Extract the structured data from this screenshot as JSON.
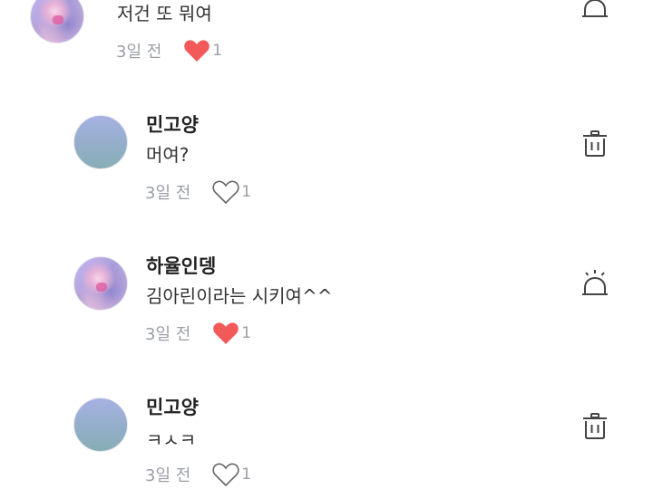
{
  "comments": [
    {
      "type": "partial",
      "text": "저건 또 뭐여",
      "time": "3일 전",
      "liked": true,
      "likes": "1",
      "action": "report-icon"
    },
    {
      "type": "reply",
      "author": "민고양",
      "text": "머여?",
      "time": "3일 전",
      "liked": false,
      "likes": "1",
      "action": "trash-icon"
    },
    {
      "type": "reply",
      "author": "하율인뎅",
      "text": "김아린이라는 시키여^^",
      "time": "3일 전",
      "liked": true,
      "likes": "1",
      "action": "report-icon"
    },
    {
      "type": "reply",
      "author": "민고양",
      "text": "ㅋㅅㅋ",
      "time": "3일 전",
      "liked": false,
      "likes": "1",
      "action": "trash-icon"
    }
  ],
  "colors": {
    "heart_filled": "#f25a5a",
    "muted_text": "#9a9ea6",
    "icon_stroke": "#444444"
  }
}
